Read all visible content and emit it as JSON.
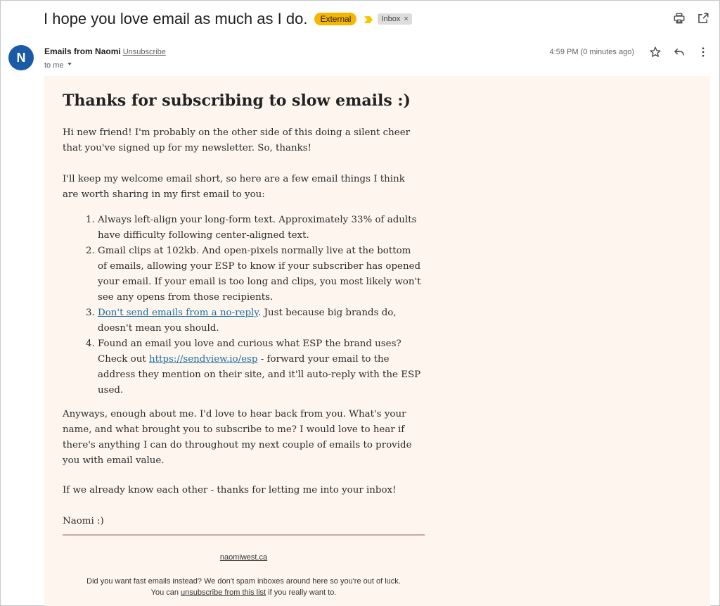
{
  "subject": "I hope you love email as much as I do.",
  "labels": {
    "external": "External",
    "inbox": "Inbox",
    "inbox_close": "×"
  },
  "sender": {
    "initial": "N",
    "name": "Emails from Naomi",
    "unsubscribe": "Unsubscribe",
    "to": "to me"
  },
  "timestamp": "4:59 PM (0 minutes ago)",
  "icons": [
    "print-icon",
    "open-in-new-window-icon",
    "star-icon",
    "reply-icon",
    "more-options-icon",
    "chevron-down-icon",
    "importance-marker-icon"
  ],
  "colors": {
    "external_badge": "#f7b500",
    "avatar": "#1a5aa6",
    "body_bg": "#fef5ee",
    "link": "#1b6fa3"
  },
  "body": {
    "heading": "Thanks for subscribing to slow emails :)",
    "p1": "Hi new friend! I'm probably on the other side of this doing a silent cheer that you've signed up for my newsletter. So, thanks!",
    "p2": "I'll keep my welcome email short, so here are a few email things I think are worth sharing in my first email to you:",
    "list": {
      "i1": "Always left-align your long-form text. Approximately 33% of adults have difficulty following center-aligned text.",
      "i2": "Gmail clips at 102kb. And open-pixels normally live at the bottom of emails, allowing your ESP to know if your subscriber has opened your email. If your email is too long and clips, you most likely won't see any opens from those recipients.",
      "i3_link": "Don't send emails from a no-reply",
      "i3_rest": ". Just because big brands do, doesn't mean you should.",
      "i4_pre": "Found an email you love and curious what ESP the brand uses? Check out ",
      "i4_link": "https://sendview.io/esp",
      "i4_post": " - forward your email to the address they mention on their site, and it'll auto-reply with the ESP used."
    },
    "p3": "Anyways, enough about me. I'd love to hear back from you. What's your name, and what brought you to subscribe to me? I would love to hear if there's anything I can do throughout my next couple of emails to provide you with email value.",
    "p4": "If we already know each other - thanks for letting me into your inbox!",
    "signoff": "Naomi :)"
  },
  "footer": {
    "site": "naomiwest.ca",
    "line1": "Did you want fast emails instead? We don't spam inboxes around here so you're out of luck.",
    "line2_pre": "You can ",
    "line2_link": "unsubscribe from this list",
    "line2_post": " if you really want to."
  }
}
